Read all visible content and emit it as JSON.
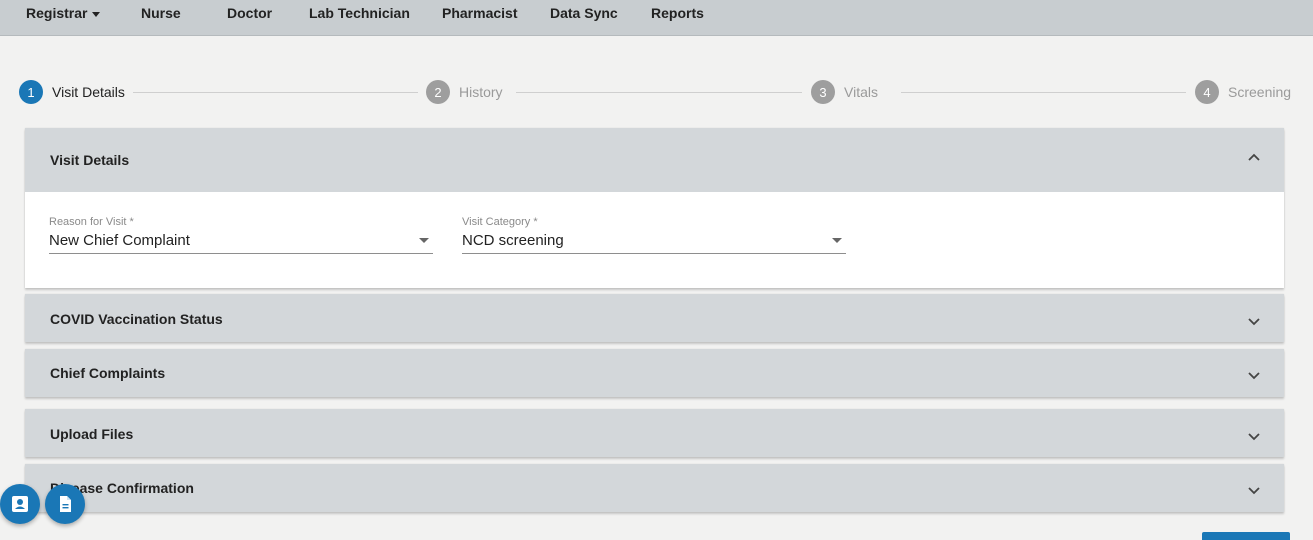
{
  "nav": {
    "items": [
      {
        "label": "Registrar",
        "has_caret": true
      },
      {
        "label": "Nurse"
      },
      {
        "label": "Doctor"
      },
      {
        "label": "Lab Technician"
      },
      {
        "label": "Pharmacist"
      },
      {
        "label": "Data Sync"
      },
      {
        "label": "Reports"
      }
    ]
  },
  "stepper": {
    "steps": [
      {
        "number": "1",
        "label": "Visit Details",
        "state": "active"
      },
      {
        "number": "2",
        "label": "History",
        "state": "inactive"
      },
      {
        "number": "3",
        "label": "Vitals",
        "state": "inactive"
      },
      {
        "number": "4",
        "label": "Screening",
        "state": "inactive"
      }
    ]
  },
  "panels": {
    "visit_details": {
      "title": "Visit Details",
      "expanded": true,
      "fields": {
        "reason": {
          "label": "Reason for Visit *",
          "value": "New Chief Complaint"
        },
        "category": {
          "label": "Visit Category *",
          "value": "NCD screening"
        }
      }
    },
    "covid": {
      "title": "COVID Vaccination Status",
      "expanded": false
    },
    "chief_complaints": {
      "title": "Chief Complaints",
      "expanded": false
    },
    "upload_files": {
      "title": "Upload Files",
      "expanded": false
    },
    "disease_confirmation": {
      "title": "Disease Confirmation",
      "expanded": false
    }
  },
  "fabs": [
    {
      "icon": "contact-card-icon"
    },
    {
      "icon": "document-icon"
    }
  ],
  "colors": {
    "primary": "#1a77b6",
    "nav_bg": "#c8cdd0",
    "panel_header_bg": "#d3d7da",
    "page_bg": "#f2f2f1"
  }
}
